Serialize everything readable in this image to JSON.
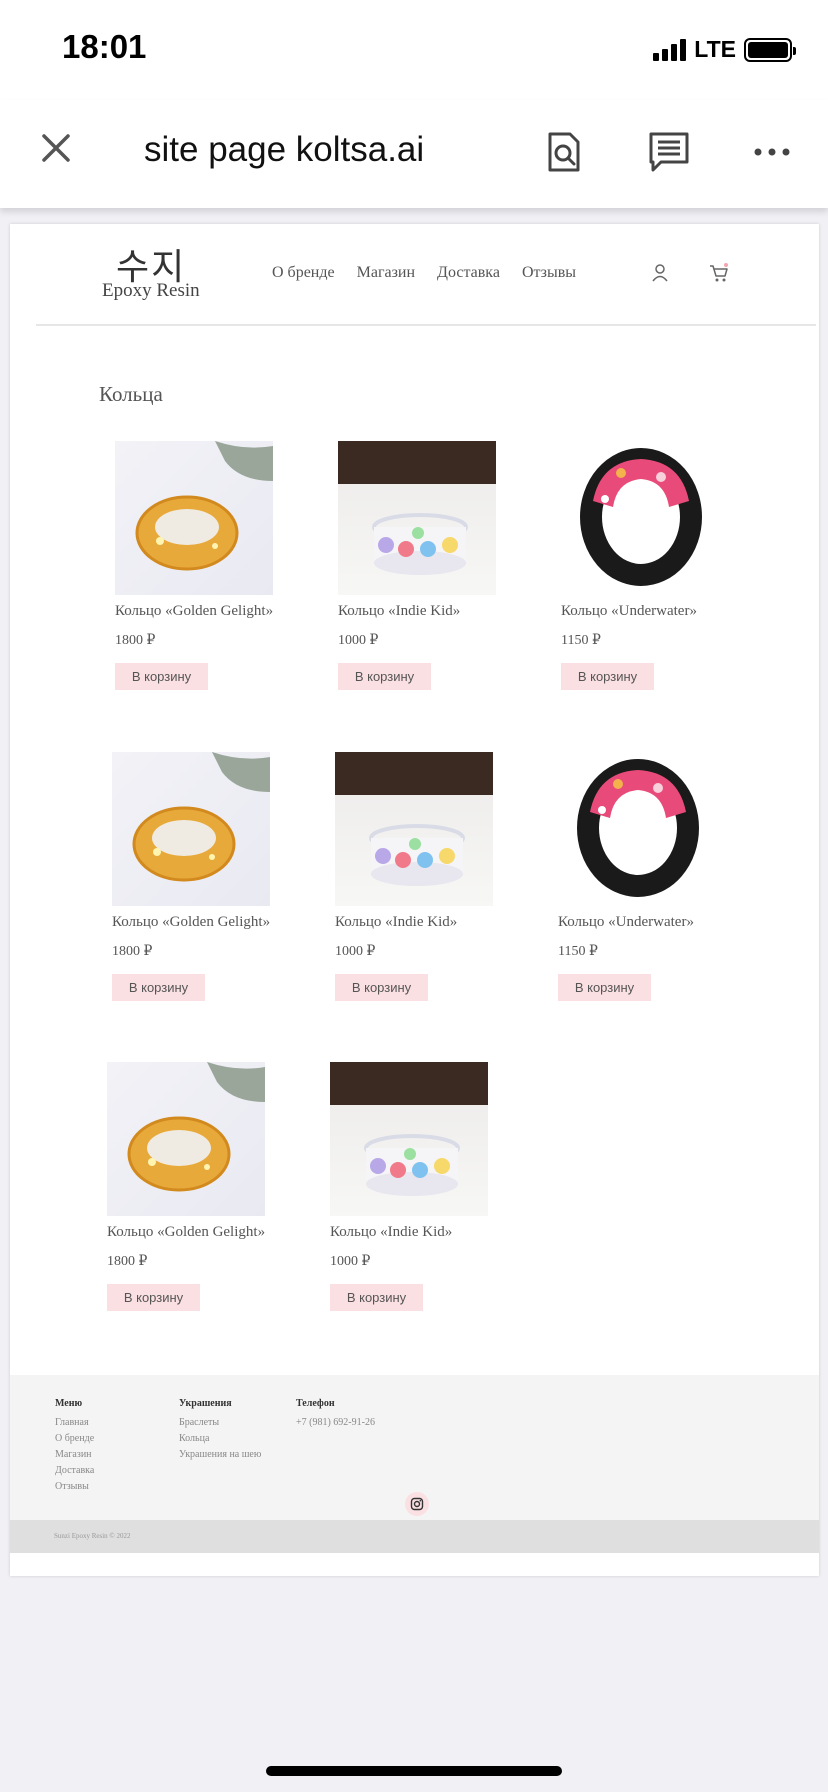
{
  "status_bar": {
    "time": "18:01",
    "network": "LTE"
  },
  "browser": {
    "title": "site page koltsa.ai"
  },
  "site": {
    "logo_korean": "수지",
    "logo_sub": "Epoxy Resin",
    "nav": [
      "О бренде",
      "Магазин",
      "Доставка",
      "Отзывы"
    ]
  },
  "section_title": "Кольца",
  "cart_button_label": "В корзину",
  "products": [
    {
      "name": "Кольцо «Golden Gelight»",
      "price": "1800 ₽",
      "image": "golden-ring-image"
    },
    {
      "name": "Кольцо «Indie Kid»",
      "price": "1000 ₽",
      "image": "indie-ring-image"
    },
    {
      "name": "Кольцо «Underwater»",
      "price": "1150 ₽",
      "image": "underwater-ring-image"
    },
    {
      "name": "Кольцо «Golden Gelight»",
      "price": "1800 ₽",
      "image": "golden-ring-image"
    },
    {
      "name": "Кольцо «Indie Kid»",
      "price": "1000 ₽",
      "image": "indie-ring-image"
    },
    {
      "name": "Кольцо «Underwater»",
      "price": "1150 ₽",
      "image": "underwater-ring-image"
    },
    {
      "name": "Кольцо «Golden Gelight»",
      "price": "1800 ₽",
      "image": "golden-ring-image"
    },
    {
      "name": "Кольцо «Indie Kid»",
      "price": "1000 ₽",
      "image": "indie-ring-image"
    }
  ],
  "footer": {
    "menu": {
      "heading": "Меню",
      "links": [
        "Главная",
        "О бренде",
        "Магазин",
        "Доставка",
        "Отзывы"
      ]
    },
    "jewelry": {
      "heading": "Украшения",
      "links": [
        "Браслеты",
        "Кольца",
        "Украшения на шею"
      ]
    },
    "phone": {
      "heading": "Телефон",
      "value": "+7 (981) 692-91-26"
    },
    "copyright": "Sunzi Epoxy Resin © 2022"
  },
  "colors": {
    "button_bg": "#fbe0e3",
    "footer_bg": "#f4f4f4",
    "copyright_bg": "#e0dfe0"
  }
}
